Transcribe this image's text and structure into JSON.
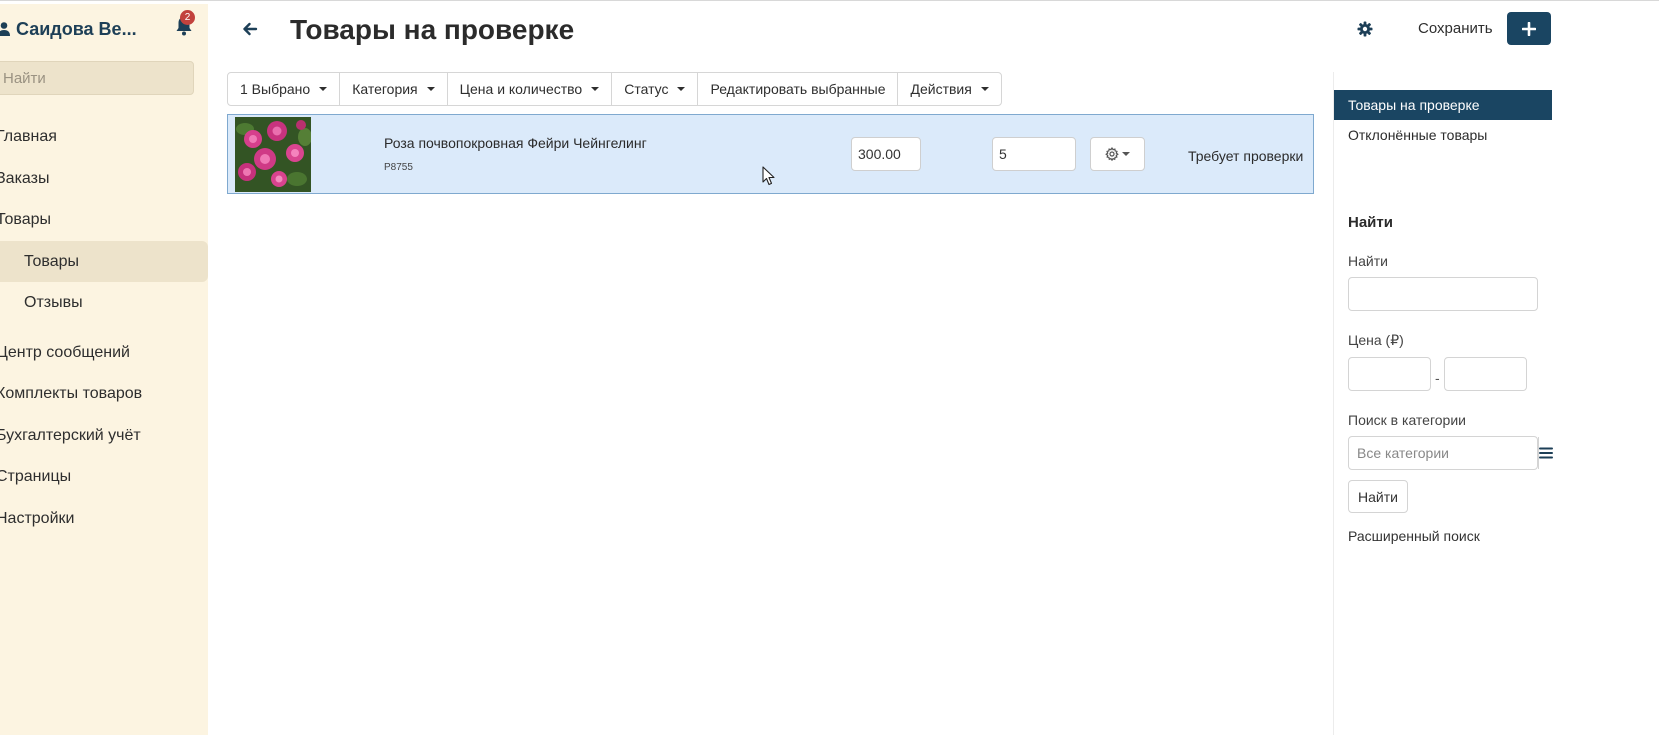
{
  "sidebar": {
    "user_name": "Саидова Ве...",
    "notification_count": "2",
    "search_placeholder": "Найти",
    "items": [
      {
        "label": "Главная"
      },
      {
        "label": "Заказы"
      },
      {
        "label": "Товары"
      },
      {
        "label": "Товары"
      },
      {
        "label": "Отзывы"
      },
      {
        "label": "Центр сообщений"
      },
      {
        "label": "Комплекты товаров"
      },
      {
        "label": "Бухгалтерский учёт"
      },
      {
        "label": "Страницы"
      },
      {
        "label": "Настройки"
      }
    ]
  },
  "header": {
    "title": "Товары на проверке",
    "save_label": "Сохранить"
  },
  "toolbar": {
    "selected": "1 Выбрано",
    "category": "Категория",
    "price_qty": "Цена и количество",
    "status": "Статус",
    "edit_selected": "Редактировать выбранные",
    "actions": "Действия"
  },
  "products": [
    {
      "name": "Роза почвопокровная Фейри Чейнгелинг",
      "code": "P8755",
      "price": "300.00",
      "quantity": "5",
      "status": "Требует проверки"
    }
  ],
  "right_panel": {
    "tabs": [
      "Товары на проверке",
      "Отклонённые товары"
    ],
    "search_heading": "Найти",
    "search_label": "Найти",
    "price_label": "Цена (₽)",
    "price_dash": "-",
    "category_label": "Поиск в категории",
    "category_placeholder": "Все категории",
    "find_button": "Найти",
    "advanced_search": "Расширенный поиск"
  },
  "colors": {
    "sidebar_bg": "#fcf4e1",
    "sidebar_active": "#ede3cb",
    "brand_dark": "#1a4562",
    "row_selected": "#dbeafa",
    "badge": "#c2423d"
  }
}
